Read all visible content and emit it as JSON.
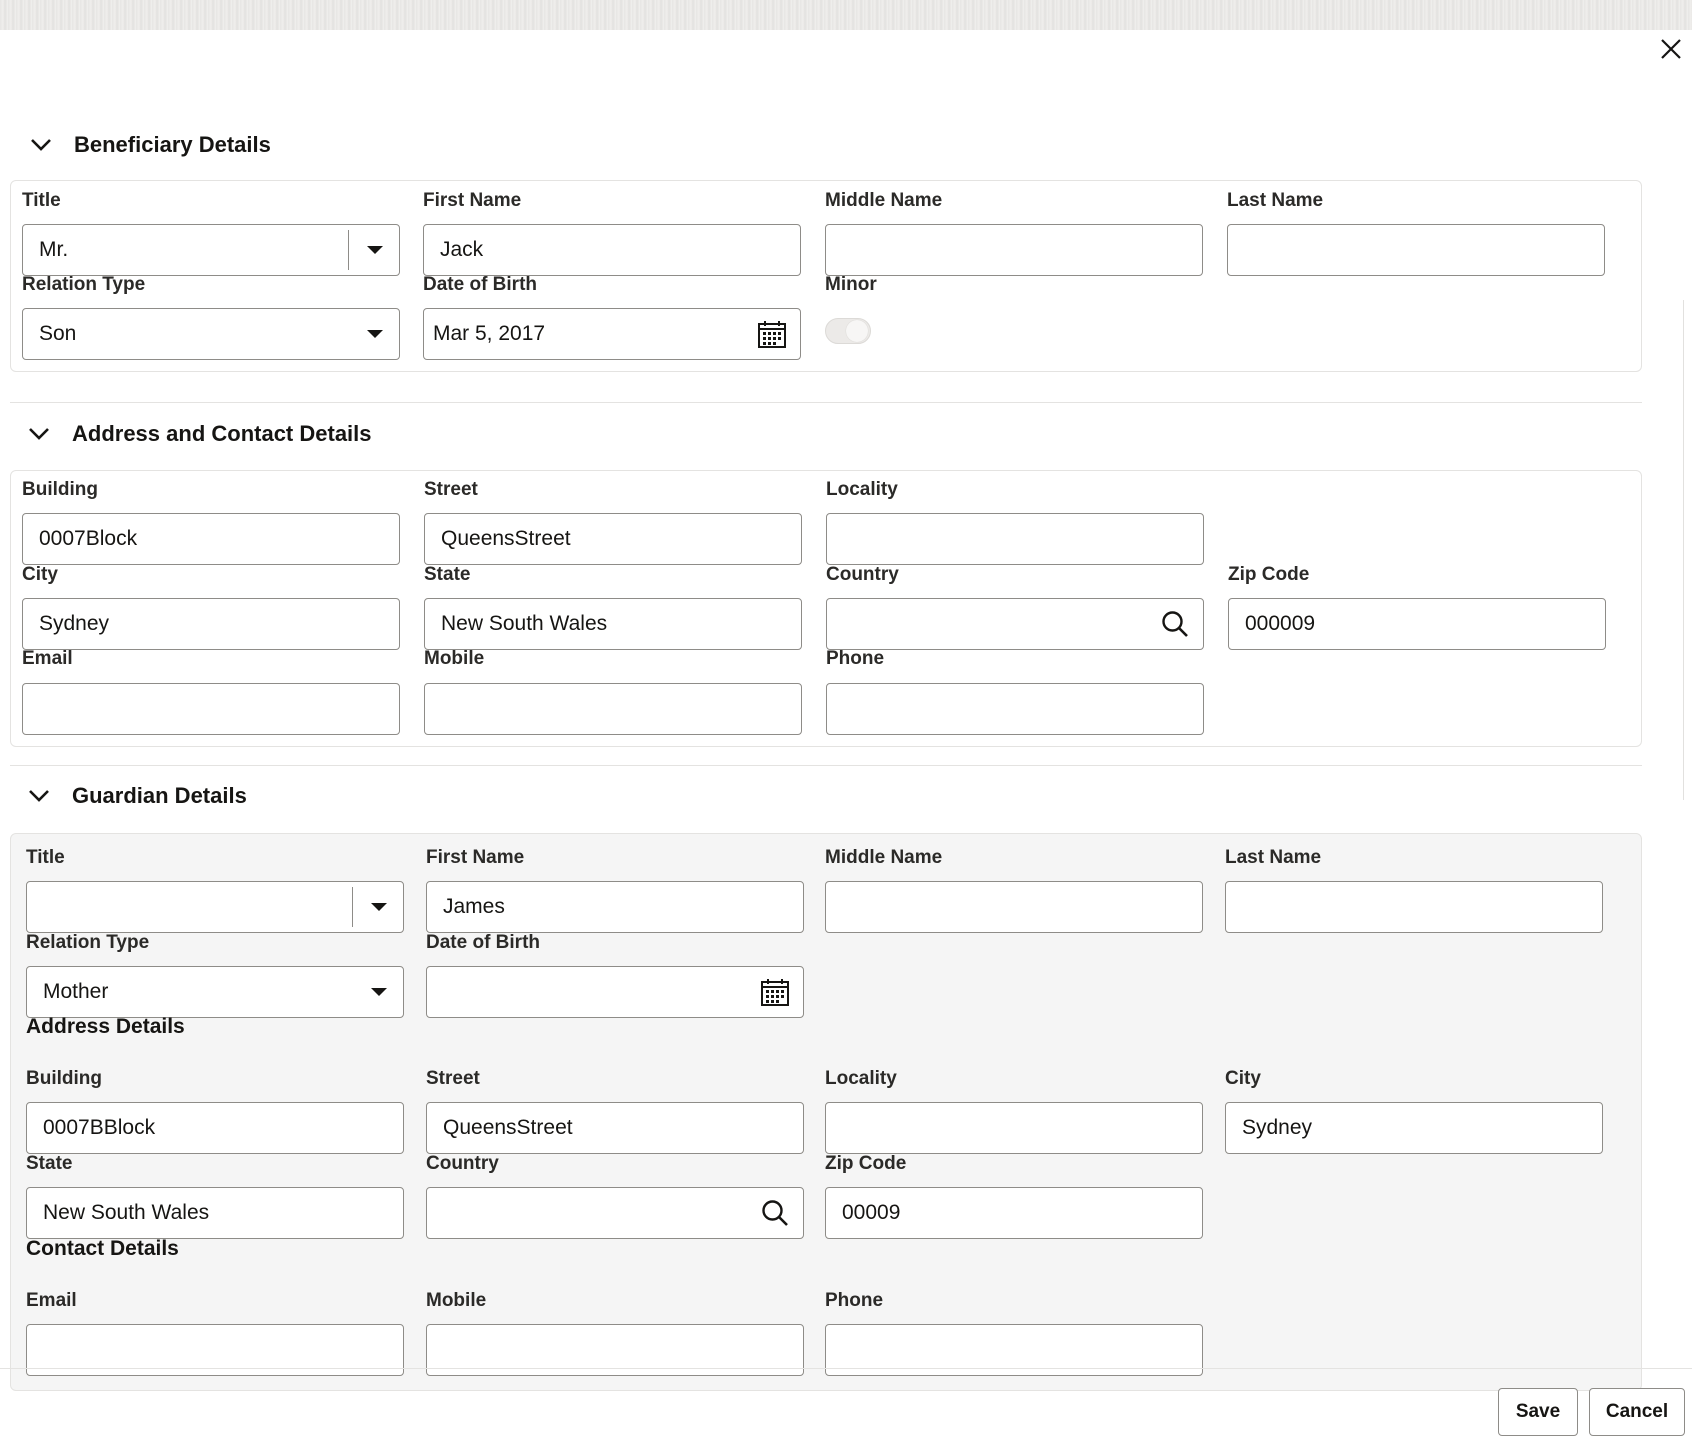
{
  "beneficiary": {
    "section_title": "Beneficiary Details",
    "title_label": "Title",
    "title_value": "Mr.",
    "first_name_label": "First Name",
    "first_name_value": "Jack",
    "middle_name_label": "Middle Name",
    "middle_name_value": "",
    "last_name_label": "Last Name",
    "last_name_value": "",
    "relation_type_label": "Relation Type",
    "relation_type_value": "Son",
    "dob_label": "Date of Birth",
    "dob_value": "Mar 5, 2017",
    "minor_label": "Minor",
    "minor_on": false
  },
  "address_contact": {
    "section_title": "Address and Contact Details",
    "building_label": "Building",
    "building_value": "0007Block",
    "street_label": "Street",
    "street_value": "QueensStreet",
    "locality_label": "Locality",
    "locality_value": "",
    "city_label": "City",
    "city_value": "Sydney",
    "state_label": "State",
    "state_value": "New South Wales",
    "country_label": "Country",
    "country_value": "",
    "zip_label": "Zip Code",
    "zip_value": "000009",
    "email_label": "Email",
    "email_value": "",
    "mobile_label": "Mobile",
    "mobile_value": "",
    "phone_label": "Phone",
    "phone_value": ""
  },
  "guardian": {
    "section_title": "Guardian Details",
    "title_label": "Title",
    "title_value": "",
    "first_name_label": "First Name",
    "first_name_value": "James",
    "middle_name_label": "Middle Name",
    "middle_name_value": "",
    "last_name_label": "Last Name",
    "last_name_value": "",
    "relation_type_label": "Relation Type",
    "relation_type_value": "Mother",
    "dob_label": "Date of Birth",
    "dob_value": "",
    "address_heading": "Address Details",
    "building_label": "Building",
    "building_value": "0007BBlock",
    "street_label": "Street",
    "street_value": "QueensStreet",
    "locality_label": "Locality",
    "locality_value": "",
    "city_label": "City",
    "city_value": "Sydney",
    "state_label": "State",
    "state_value": "New South Wales",
    "country_label": "Country",
    "country_value": "",
    "zip_label": "Zip Code",
    "zip_value": "00009",
    "contact_heading": "Contact Details",
    "email_label": "Email",
    "email_value": "",
    "mobile_label": "Mobile",
    "mobile_value": "",
    "phone_label": "Phone",
    "phone_value": ""
  },
  "footer": {
    "save_label": "Save",
    "cancel_label": "Cancel"
  },
  "icons": {
    "close": "close-icon",
    "collapse": "chevron-down-icon",
    "dropdown": "caret-down-icon",
    "calendar": "calendar-icon",
    "search": "search-icon"
  }
}
